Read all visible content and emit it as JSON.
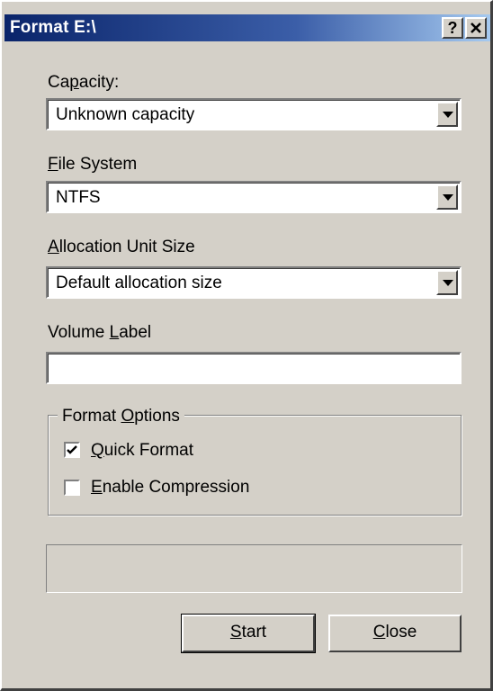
{
  "window": {
    "title": "Format E:\\",
    "help_label": "?",
    "close_label": "✕"
  },
  "capacity": {
    "label_pre": "Ca",
    "label_key": "p",
    "label_post": "acity:",
    "value": "Unknown capacity"
  },
  "file_system": {
    "label_pre": "",
    "label_key": "F",
    "label_post": "ile System",
    "value": "NTFS"
  },
  "allocation": {
    "label_pre": "",
    "label_key": "A",
    "label_post": "llocation Unit Size",
    "value": "Default allocation size"
  },
  "volume_label": {
    "label_pre": "Volume ",
    "label_key": "L",
    "label_post": "abel",
    "value": ""
  },
  "options": {
    "title_pre": "Format ",
    "title_key": "O",
    "title_post": "ptions",
    "quick": {
      "key": "Q",
      "rest": "uick Format",
      "checked": true
    },
    "compress": {
      "key": "E",
      "rest": "nable Compression",
      "checked": false
    }
  },
  "buttons": {
    "start": {
      "key": "S",
      "rest": "tart"
    },
    "close": {
      "key": "C",
      "rest": "lose"
    }
  }
}
